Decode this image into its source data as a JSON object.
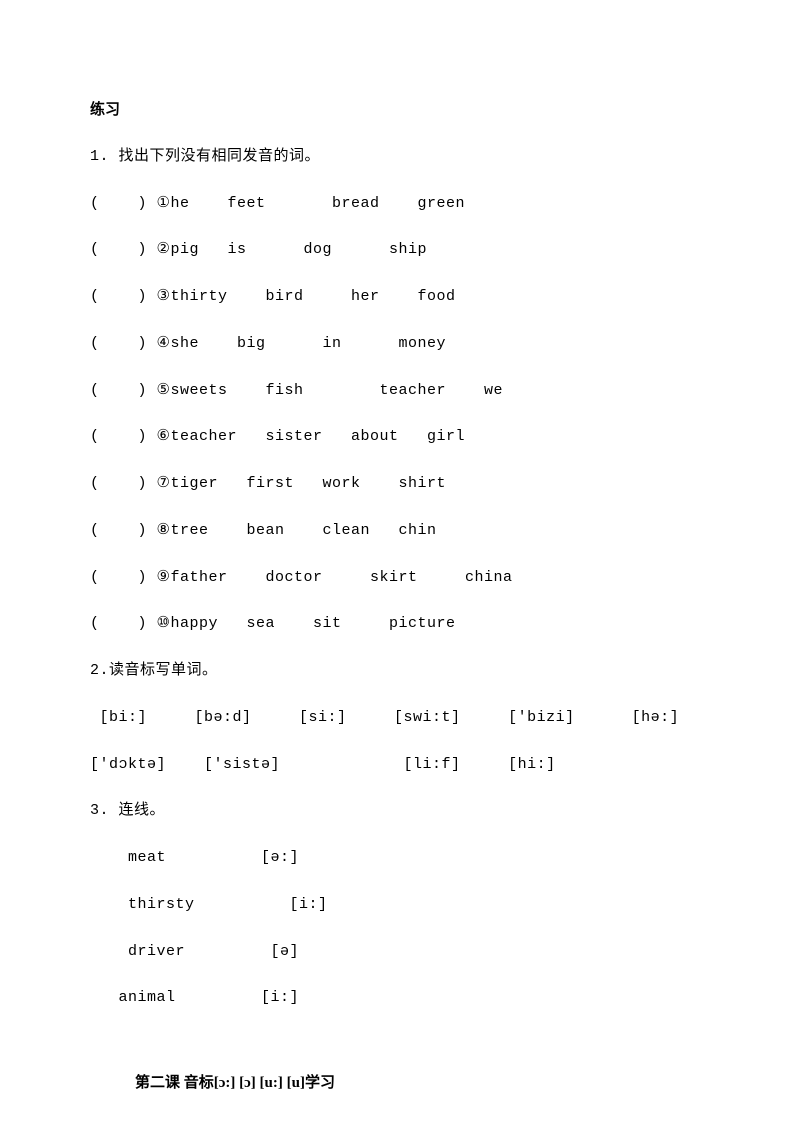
{
  "title": "练习",
  "q1": {
    "heading": "1. 找出下列没有相同发音的词。",
    "items": [
      "(    ) ①he    feet       bread    green",
      "(    ) ②pig   is      dog      ship",
      "(    ) ③thirty    bird     her    food",
      "(    ) ④she    big      in      money",
      "(    ) ⑤sweets    fish        teacher    we",
      "(    ) ⑥teacher   sister   about   girl",
      "(    ) ⑦tiger   first   work    shirt",
      "(    ) ⑧tree    bean    clean   chin",
      "(    ) ⑨father    doctor     skirt     china",
      "(    ) ⑩happy   sea    sit     picture"
    ]
  },
  "q2": {
    "heading": "2.读音标写单词。",
    "lines": [
      " [bi:]     [bə:d]     [si:]     [swi:t]     ['bizi]      [hə:]",
      "['dɔktə]    ['sistə]             [li:f]     [hi:]"
    ]
  },
  "q3": {
    "heading": "3. 连线。",
    "lines": [
      "    meat          [ə:]",
      "    thirsty          [i:]",
      "    driver         [ə]",
      "   animal         [i:]"
    ]
  },
  "lesson": "第二课  音标[ɔ:] [ɔ] [u:] [u]学习"
}
